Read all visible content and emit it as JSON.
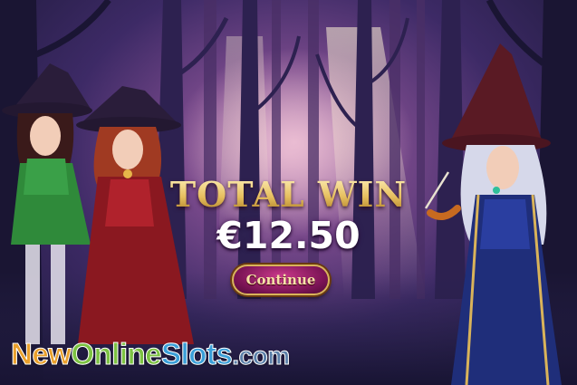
{
  "win_panel": {
    "title": "TOTAL WIN",
    "amount": "€12.50",
    "continue_label": "Continue"
  },
  "watermark": {
    "part_new": "New",
    "part_online": "Online",
    "part_slots": "Slots",
    "part_com": ".com"
  },
  "colors": {
    "title_gold": "#e7c060",
    "button_magenta": "#9c1e6a",
    "background_purple": "#3d2a66"
  },
  "characters": {
    "left_witch_green": "witch-green-dress",
    "left_witch_red": "witch-red-dress",
    "right_witch_blue": "witch-blue-dress"
  }
}
